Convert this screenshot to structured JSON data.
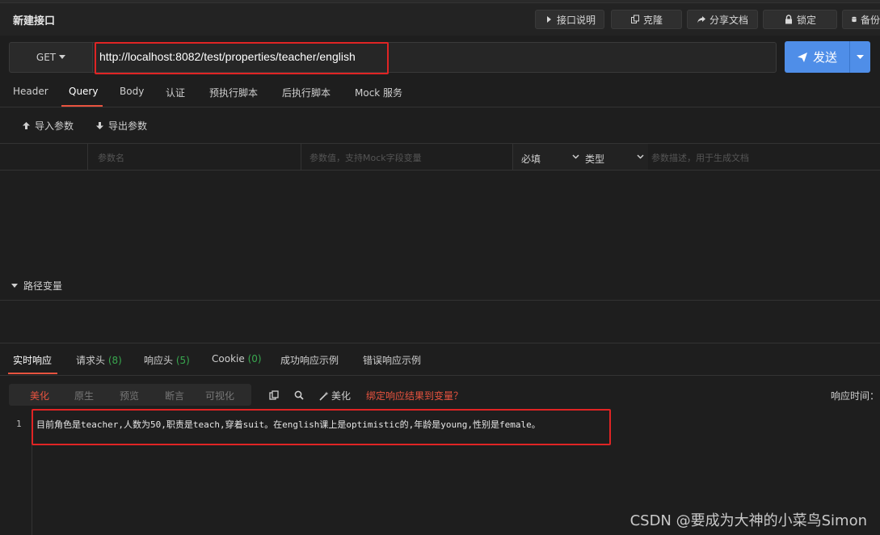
{
  "title": "新建接口",
  "toolbar": {
    "doc_label": "接口说明",
    "clone_label": "克隆",
    "share_label": "分享文档",
    "lock_label": "锁定",
    "backup_label": "备份"
  },
  "request": {
    "method": "GET",
    "url": "http://localhost:8082/test/properties/teacher/english",
    "send_label": "发送"
  },
  "request_tabs": [
    "Header",
    "Query",
    "Body",
    "认证",
    "预执行脚本",
    "后执行脚本",
    "Mock 服务"
  ],
  "active_request_tab": "Query",
  "params": {
    "import_label": "导入参数",
    "export_label": "导出参数",
    "name_placeholder": "参数名",
    "value_placeholder": "参数值，支持Mock字段变量",
    "required_label": "必填",
    "type_label": "类型",
    "desc_placeholder": "参数描述，用于生成文档"
  },
  "path_vars_label": "路径变量",
  "response_tabs": {
    "live": "实时响应",
    "req_headers": "请求头",
    "req_headers_count": "(8)",
    "resp_headers": "响应头",
    "resp_headers_count": "(5)",
    "cookie": "Cookie",
    "cookie_count": "(0)",
    "success_example": "成功响应示例",
    "error_example": "错误响应示例"
  },
  "view_modes": [
    "美化",
    "原生",
    "预览",
    "断言",
    "可视化"
  ],
  "active_view_mode": "美化",
  "response_tools": {
    "beautify_label": "美化",
    "bind_label": "绑定响应结果到变量？",
    "time_label": "响应时间："
  },
  "response_body": {
    "line_number": "1",
    "text": "目前角色是teacher,人数为50,职责是teach,穿着suit。在english课上是optimistic的,年龄是young,性别是female。"
  },
  "watermark": "CSDN @要成为大神的小菜鸟Simon",
  "colors": {
    "accent": "#e8533f",
    "primary": "#4f8ee8",
    "highlight_box": "#e02424",
    "count_green": "#39a84f"
  }
}
